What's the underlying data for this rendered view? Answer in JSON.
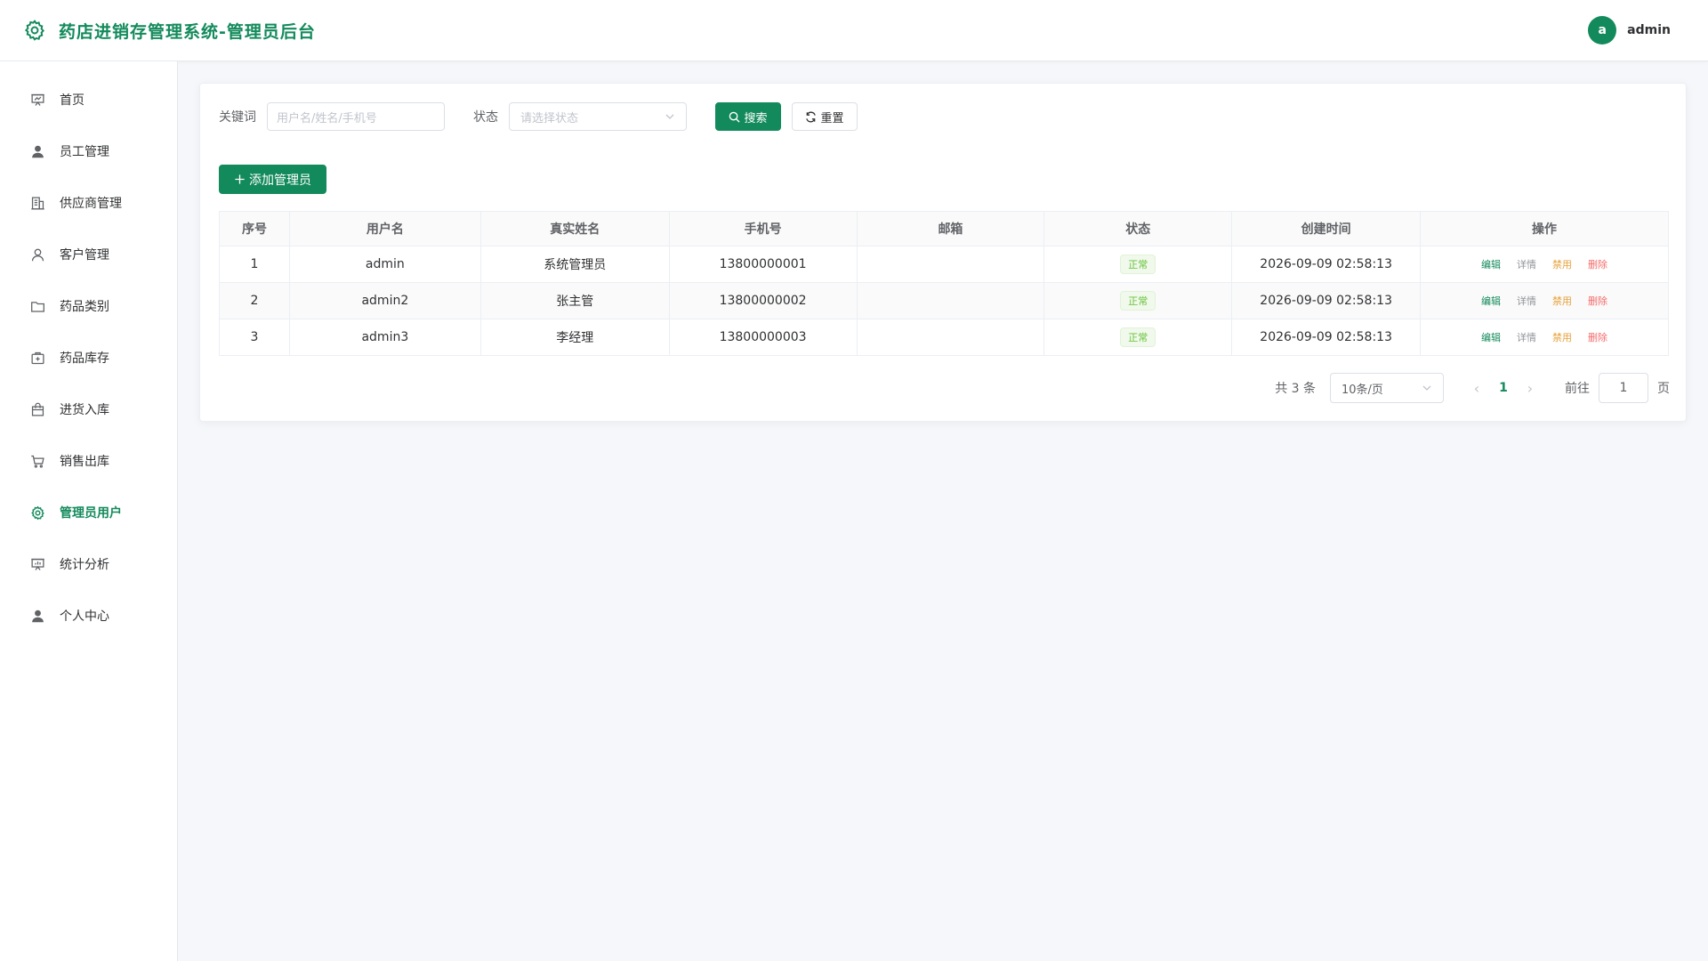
{
  "header": {
    "title": "药店进销存管理系统-管理员后台",
    "avatar_letter": "a",
    "user_name": "admin"
  },
  "sidebar": {
    "items": [
      {
        "label": "首页",
        "icon": "presentation-icon"
      },
      {
        "label": "员工管理",
        "icon": "user-icon"
      },
      {
        "label": "供应商管理",
        "icon": "office-building-icon"
      },
      {
        "label": "客户管理",
        "icon": "user-outline-icon"
      },
      {
        "label": "药品类别",
        "icon": "folder-icon"
      },
      {
        "label": "药品库存",
        "icon": "first-aid-kit-icon"
      },
      {
        "label": "进货入库",
        "icon": "shopping-bag-icon"
      },
      {
        "label": "销售出库",
        "icon": "shopping-cart-icon"
      },
      {
        "label": "管理员用户",
        "icon": "gear-icon",
        "active": true
      },
      {
        "label": "统计分析",
        "icon": "data-board-icon"
      },
      {
        "label": "个人中心",
        "icon": "user-icon"
      }
    ]
  },
  "filters": {
    "keyword_label": "关键词",
    "keyword_placeholder": "用户名/姓名/手机号",
    "status_label": "状态",
    "status_placeholder": "请选择状态",
    "search_label": "搜索",
    "reset_label": "重置"
  },
  "add_button_label": "添加管理员",
  "table": {
    "columns": [
      "序号",
      "用户名",
      "真实姓名",
      "手机号",
      "邮箱",
      "状态",
      "创建时间",
      "操作"
    ],
    "rows": [
      {
        "index": "1",
        "username": "admin",
        "real_name": "系统管理员",
        "phone": "13800000001",
        "email": "",
        "status": "正常",
        "created": "2026-09-09 02:58:13"
      },
      {
        "index": "2",
        "username": "admin2",
        "real_name": "张主管",
        "phone": "13800000002",
        "email": "",
        "status": "正常",
        "created": "2026-09-09 02:58:13"
      },
      {
        "index": "3",
        "username": "admin3",
        "real_name": "李经理",
        "phone": "13800000003",
        "email": "",
        "status": "正常",
        "created": "2026-09-09 02:58:13"
      }
    ],
    "actions": {
      "edit": "编辑",
      "detail": "详情",
      "disable": "禁用",
      "delete": "删除"
    }
  },
  "pagination": {
    "total_text": "共 3 条",
    "page_size": "10条/页",
    "current_page": "1",
    "goto_label": "前往",
    "goto_value": "1",
    "page_suffix": "页"
  },
  "colors": {
    "primary": "#138a5c",
    "success_tag": "#67c23a",
    "warning": "#e6a23c",
    "danger": "#f56c6c"
  }
}
